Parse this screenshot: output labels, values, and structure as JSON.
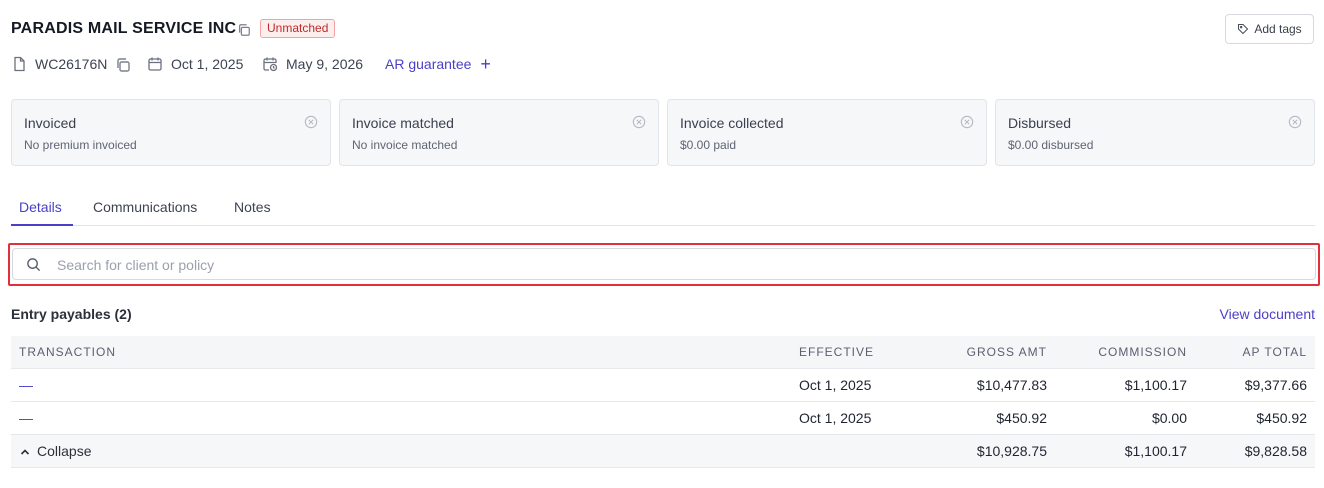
{
  "header": {
    "company_name": "PARADIS MAIL SERVICE INC",
    "status_badge": "Unmatched",
    "add_tags_label": "Add tags"
  },
  "meta": {
    "policy_number": "WC26176N",
    "start_date": "Oct 1, 2025",
    "end_date": "May 9, 2026",
    "ar_guarantee_label": "AR guarantee"
  },
  "cards": [
    {
      "title": "Invoiced",
      "subtitle": "No premium invoiced"
    },
    {
      "title": "Invoice matched",
      "subtitle": "No invoice matched"
    },
    {
      "title": "Invoice collected",
      "subtitle": "$0.00 paid"
    },
    {
      "title": "Disbursed",
      "subtitle": "$0.00 disbursed"
    }
  ],
  "tabs": [
    {
      "label": "Details",
      "active": true
    },
    {
      "label": "Communications",
      "active": false
    },
    {
      "label": "Notes",
      "active": false
    }
  ],
  "search": {
    "placeholder": "Search for client or policy",
    "value": ""
  },
  "payables": {
    "title": "Entry payables (2)",
    "view_document_label": "View document",
    "columns": [
      "TRANSACTION",
      "EFFECTIVE",
      "GROSS AMT",
      "COMMISSION",
      "AP TOTAL"
    ],
    "rows": [
      {
        "transaction": "—",
        "effective": "Oct 1, 2025",
        "gross": "$10,477.83",
        "commission": "$1,100.17",
        "ap_total": "$9,377.66"
      },
      {
        "transaction": "—",
        "effective": "Oct 1, 2025",
        "gross": "$450.92",
        "commission": "$0.00",
        "ap_total": "$450.92"
      }
    ],
    "totals": {
      "collapse_label": "Collapse",
      "gross": "$10,928.75",
      "commission": "$1,100.17",
      "ap_total": "$9,828.58"
    }
  },
  "colors": {
    "accent": "#4b3fc8",
    "badge_text": "#c02929",
    "badge_bg": "#fdeeee",
    "highlight_border": "#e0303a"
  },
  "icons": {
    "copy": "copy-icon",
    "document": "document-icon",
    "calendar": "calendar-icon",
    "calendar_clock": "calendar-clock-icon",
    "tag": "tag-icon",
    "plus": "plus-icon",
    "close_circle": "close-circle-icon",
    "search": "search-icon",
    "chevron_up": "chevron-up-icon"
  }
}
